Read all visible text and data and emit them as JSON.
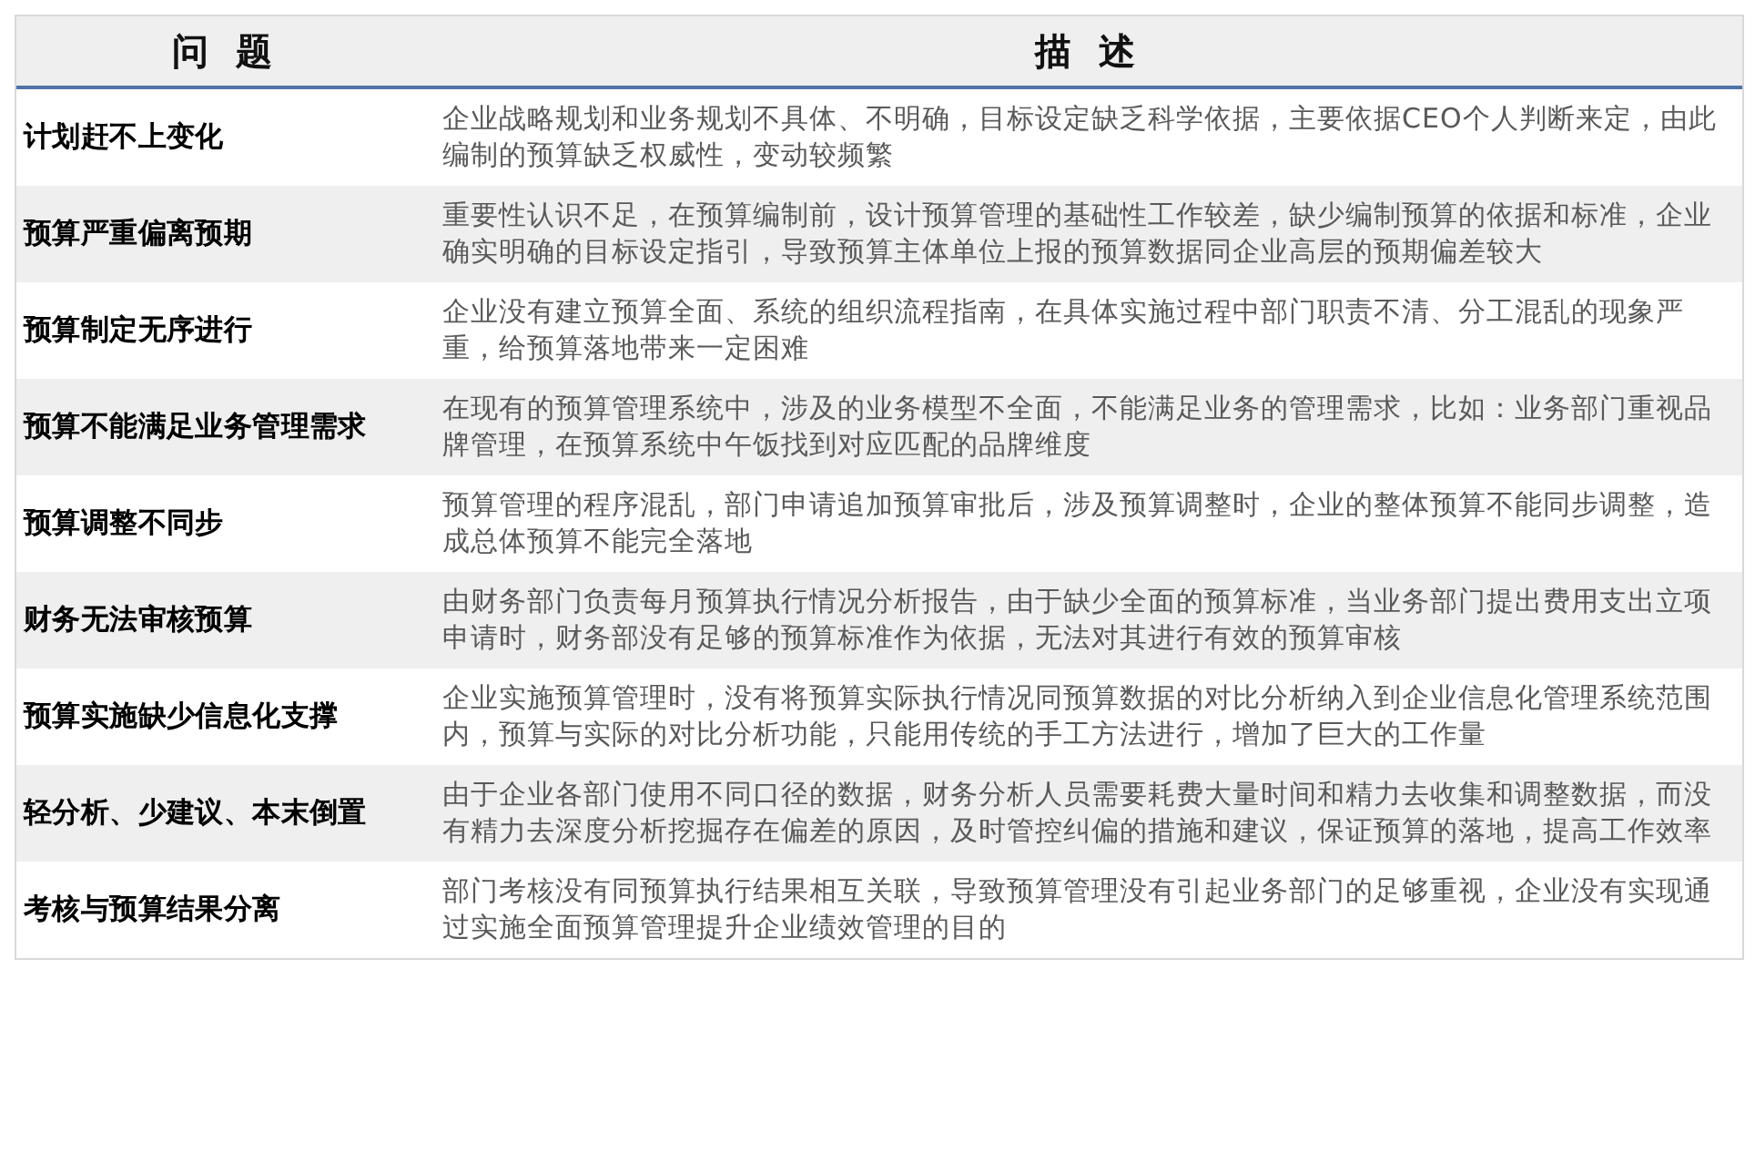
{
  "table": {
    "columns": [
      "问 题",
      "描 述"
    ],
    "rows": [
      {
        "problem": "计划赶不上变化",
        "description": "企业战略规划和业务规划不具体、不明确，目标设定缺乏科学依据，主要依据CEO个人判断来定，由此编制的预算缺乏权威性，变动较频繁"
      },
      {
        "problem": "预算严重偏离预期",
        "description": "重要性认识不足，在预算编制前，设计预算管理的基础性工作较差，缺少编制预算的依据和标准，企业确实明确的目标设定指引，导致预算主体单位上报的预算数据同企业高层的预期偏差较大"
      },
      {
        "problem": "预算制定无序进行",
        "description": "企业没有建立预算全面、系统的组织流程指南，在具体实施过程中部门职责不清、分工混乱的现象严重，给预算落地带来一定困难"
      },
      {
        "problem": "预算不能满足业务管理需求",
        "description": "在现有的预算管理系统中，涉及的业务模型不全面，不能满足业务的管理需求，比如：业务部门重视品牌管理，在预算系统中午饭找到对应匹配的品牌维度"
      },
      {
        "problem": "预算调整不同步",
        "description": "预算管理的程序混乱，部门申请追加预算审批后，涉及预算调整时，企业的整体预算不能同步调整，造成总体预算不能完全落地"
      },
      {
        "problem": "财务无法审核预算",
        "description": "由财务部门负责每月预算执行情况分析报告，由于缺少全面的预算标准，当业务部门提出费用支出立项申请时，财务部没有足够的预算标准作为依据，无法对其进行有效的预算审核"
      },
      {
        "problem": "预算实施缺少信息化支撑",
        "description": "企业实施预算管理时，没有将预算实际执行情况同预算数据的对比分析纳入到企业信息化管理系统范围内，预算与实际的对比分析功能，只能用传统的手工方法进行，增加了巨大的工作量"
      },
      {
        "problem": "轻分析、少建议、本末倒置",
        "description": "由于企业各部门使用不同口径的数据，财务分析人员需要耗费大量时间和精力去收集和调整数据，而没有精力去深度分析挖掘存在偏差的原因，及时管控纠偏的措施和建议，保证预算的落地，提高工作效率"
      },
      {
        "problem": "考核与预算结果分离",
        "description": "部门考核没有同预算执行结果相互关联，导致预算管理没有引起业务部门的足够重视，企业没有实现通过实施全面预算管理提升企业绩效管理的目的"
      }
    ]
  }
}
